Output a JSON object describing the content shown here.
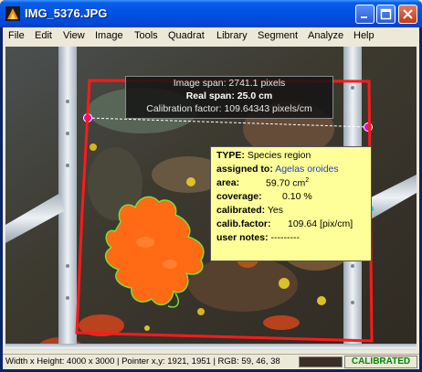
{
  "window": {
    "title": "IMG_5376.JPG"
  },
  "menu": [
    "File",
    "Edit",
    "View",
    "Image",
    "Tools",
    "Quadrat",
    "Library",
    "Segment",
    "Analyze",
    "Help"
  ],
  "hud": {
    "image_span": "Image span: 2741.1 pixels",
    "real_span": "Real span:  25.0 cm",
    "calibration": "Calibration factor: 109.64343 pixels/cm"
  },
  "tooltip": {
    "type_label": "TYPE:",
    "type_value": "Species region",
    "assigned_label": "assigned to:",
    "assigned_value": "Agelas oroides",
    "area_label": "area:",
    "area_value": "59.70",
    "area_unit": "cm",
    "area_unit_sup": "2",
    "coverage_label": "coverage:",
    "coverage_value": "0.10 %",
    "calibrated_label": "calibrated:",
    "calibrated_value": "Yes",
    "factor_label": "calib.factor:",
    "factor_value": "109.64 [pix/cm]",
    "notes_label": "user notes:",
    "notes_value": "---------"
  },
  "status": {
    "info": "Width x Height: 4000 x 3000 | Pointer x,y: 1921, 1951 | RGB:  59, 46, 38",
    "calibrated": "CALIBRATED",
    "swatch_color": "#3b2e26"
  },
  "colors": {
    "quadrat_border": "#ff1a1a",
    "region_outline": "#7ddc3a",
    "region_fill": "#ff6a14",
    "calibration_handle": "#e800e8",
    "arrow": "#2fbde8",
    "titlebar": "#0054e3"
  }
}
